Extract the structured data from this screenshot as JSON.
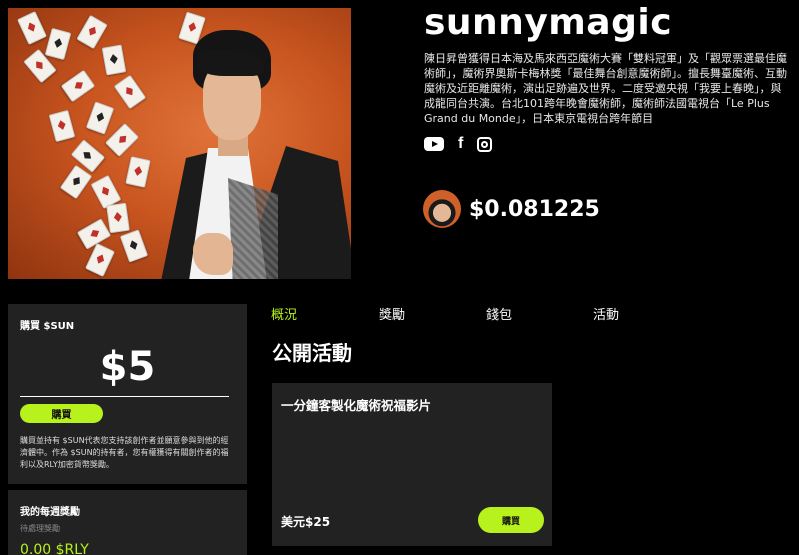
{
  "creator": {
    "name": "sunnymagic",
    "bio": "陳日昇曾獲得日本海及馬來西亞魔術大賽「雙料冠軍」及「觀眾票選最佳魔術師」，魔術界奧斯卡梅林獎「最佳舞台創意魔術師」。擅長舞臺魔術、互動魔術及近距離魔術，演出足跡遍及世界。二度受邀央視「我要上春晚」，與成龍同台共演。台北101跨年晚會魔術師，魔術師法國電視台「Le Plus Grand du Monde」，日本東京電視台跨年節目",
    "socials": [
      "youtube-icon",
      "facebook-icon",
      "instagram-icon"
    ],
    "facebook_glyph": "f",
    "token_price": "$0.081225"
  },
  "buy": {
    "title": "購買 $SUN",
    "amount": "$5",
    "button_label": "購買",
    "description": "購買並持有 $SUN代表您支持該創作者並願意參與到他的經濟體中。作為 $SUN的持有者，您有權獲得有關創作者的福利以及RLY加密貨幣獎勵。"
  },
  "rewards": {
    "title": "我的每週獎勵",
    "subtitle": "待處理獎勵",
    "value": "0.00 $RLY"
  },
  "tabs": [
    {
      "label": "概況",
      "active": true
    },
    {
      "label": "獎勵",
      "active": false
    },
    {
      "label": "錢包",
      "active": false
    },
    {
      "label": "活動",
      "active": false
    }
  ],
  "activities": {
    "section_title": "公開活動",
    "items": [
      {
        "title": "一分鐘客製化魔術祝福影片",
        "price": "美元$25",
        "button_label": "購買"
      }
    ]
  },
  "colors": {
    "accent": "#b8f21d",
    "background": "#000000",
    "panel": "#222222"
  }
}
